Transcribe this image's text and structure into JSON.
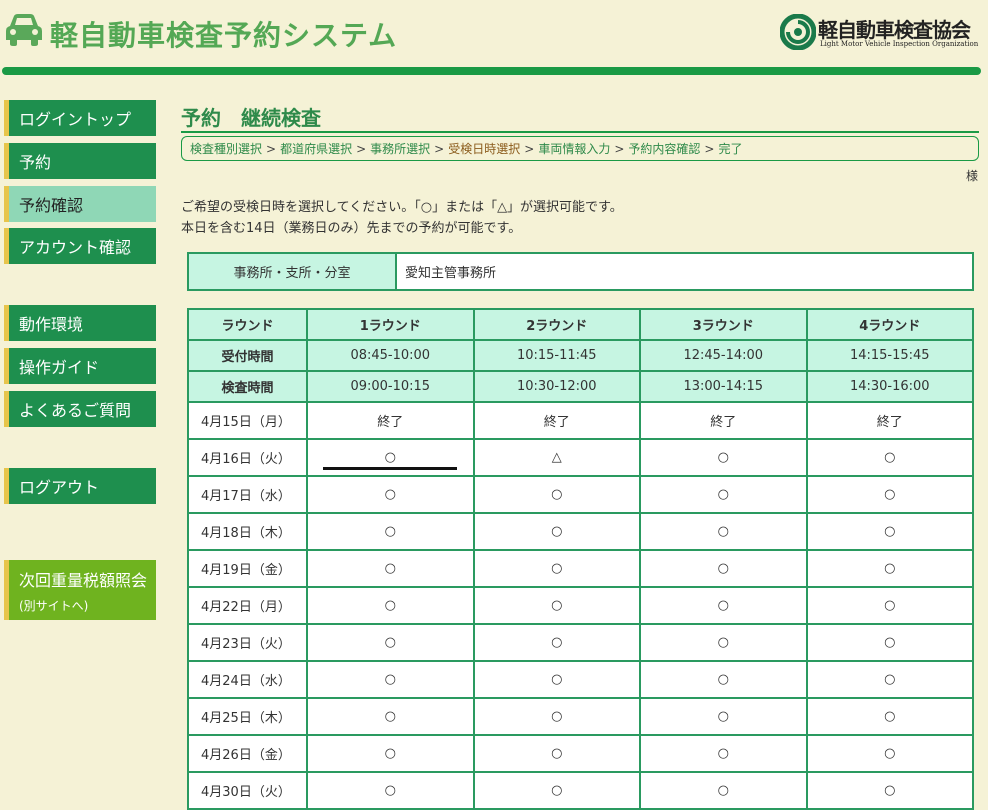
{
  "header": {
    "app_title": "軽自動車検査予約システム",
    "org_name": "軽自動車検査協会",
    "org_sub": "Light Motor Vehicle Inspection Organization"
  },
  "sidebar": {
    "items": [
      {
        "label": "ログイントップ"
      },
      {
        "label": "予約"
      },
      {
        "label": "予約確認"
      },
      {
        "label": "アカウント確認"
      },
      {
        "label": "動作環境"
      },
      {
        "label": "操作ガイド"
      },
      {
        "label": "よくあるご質問"
      },
      {
        "label": "ログアウト"
      }
    ],
    "external": {
      "label": "次回重量税額照会",
      "sub": "(別サイトへ)"
    }
  },
  "page": {
    "title": "予約　継続検査",
    "breadcrumb": [
      "検査種別選択",
      "都道府県選択",
      "事務所選択",
      "受検日時選択",
      "車両情報入力",
      "予約内容確認",
      "完了"
    ],
    "user_suffix": "様",
    "instruction1": "ご希望の受検日時を選択してください。「○」または「△」が選択可能です。",
    "instruction2": "本日を含む14日（業務日のみ）先までの予約が可能です。"
  },
  "office": {
    "label": "事務所・支所・分室",
    "value": "愛知主管事務所"
  },
  "schedule": {
    "round_label": "ラウンド",
    "reception_label": "受付時間",
    "inspection_label": "検査時間",
    "rounds": [
      {
        "name": "1ラウンド",
        "reception": "08:45-10:00",
        "inspection": "09:00-10:15"
      },
      {
        "name": "2ラウンド",
        "reception": "10:15-11:45",
        "inspection": "10:30-12:00"
      },
      {
        "name": "3ラウンド",
        "reception": "12:45-14:00",
        "inspection": "13:00-14:15"
      },
      {
        "name": "4ラウンド",
        "reception": "14:15-15:45",
        "inspection": "14:30-16:00"
      }
    ],
    "days": [
      {
        "date": "4月15日（月）",
        "slots": [
          "終了",
          "終了",
          "終了",
          "終了"
        ]
      },
      {
        "date": "4月16日（火）",
        "slots": [
          "○",
          "△",
          "○",
          "○"
        ]
      },
      {
        "date": "4月17日（水）",
        "slots": [
          "○",
          "○",
          "○",
          "○"
        ]
      },
      {
        "date": "4月18日（木）",
        "slots": [
          "○",
          "○",
          "○",
          "○"
        ]
      },
      {
        "date": "4月19日（金）",
        "slots": [
          "○",
          "○",
          "○",
          "○"
        ]
      },
      {
        "date": "4月22日（月）",
        "slots": [
          "○",
          "○",
          "○",
          "○"
        ]
      },
      {
        "date": "4月23日（火）",
        "slots": [
          "○",
          "○",
          "○",
          "○"
        ]
      },
      {
        "date": "4月24日（水）",
        "slots": [
          "○",
          "○",
          "○",
          "○"
        ]
      },
      {
        "date": "4月25日（木）",
        "slots": [
          "○",
          "○",
          "○",
          "○"
        ]
      },
      {
        "date": "4月26日（金）",
        "slots": [
          "○",
          "○",
          "○",
          "○"
        ]
      },
      {
        "date": "4月30日（火）",
        "slots": [
          "○",
          "○",
          "○",
          "○"
        ]
      }
    ]
  },
  "colors": {
    "brand_green": "#1a9a45",
    "nav_green": "#1e8f4e",
    "nav_active": "#8fd7b6",
    "header_cell": "#c6f5e2",
    "lime": "#6fb31f",
    "accent_yellow": "#e7c54a"
  }
}
